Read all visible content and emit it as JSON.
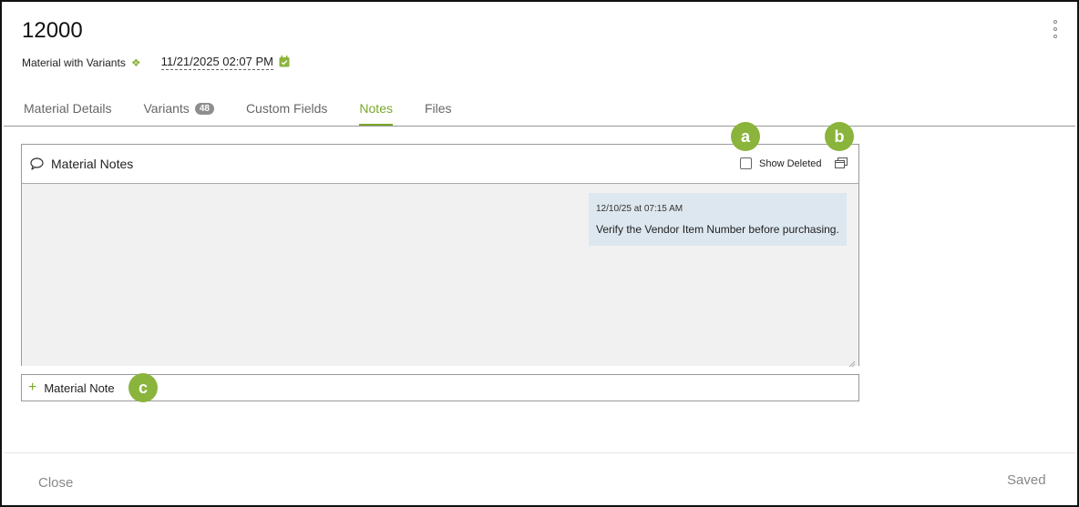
{
  "record": {
    "title": "12000",
    "type_label": "Material with Variants",
    "date": "11/21/2025 02:07 PM"
  },
  "tabs": [
    {
      "label": "Material Details",
      "active": false
    },
    {
      "label": "Variants",
      "badge": "48",
      "active": false
    },
    {
      "label": "Custom Fields",
      "active": false
    },
    {
      "label": "Notes",
      "active": true
    },
    {
      "label": "Files",
      "active": false
    }
  ],
  "notes_panel": {
    "title": "Material Notes",
    "show_deleted_label": "Show Deleted",
    "show_deleted_checked": false,
    "notes": [
      {
        "timestamp": "12/10/25 at 07:15 AM",
        "text": "Verify the Vendor Item Number before purchasing."
      }
    ]
  },
  "add_note": {
    "label": "Material Note"
  },
  "footer": {
    "close_label": "Close",
    "status": "Saved"
  },
  "callouts": {
    "a": "a",
    "b": "b",
    "c": "c"
  },
  "colors": {
    "accent": "#7aa82b",
    "callout": "#8ab43c",
    "note_bg": "#dde7ef",
    "notes_body_bg": "#f1f1f1"
  },
  "icons": [
    "kebab-menu-icon",
    "variant-diamond-icon",
    "calendar-check-icon",
    "chat-bubble-icon",
    "popout-window-icon",
    "plus-icon",
    "resize-grip-icon"
  ]
}
